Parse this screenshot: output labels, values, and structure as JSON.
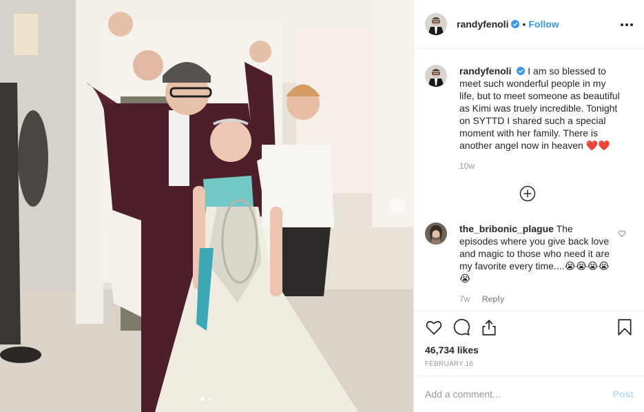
{
  "post": {
    "username": "randyfenoli",
    "separator": "•",
    "follow_label": "Follow",
    "colors": {
      "accent": "#3897f0",
      "verified": "#3897f0",
      "text": "#262626",
      "muted": "#999999",
      "post_disabled": "#b2dffc"
    }
  },
  "caption": {
    "username": "randyfenoli",
    "text": "I am so blessed to meet such wonderful people in my life, but to meet someone as beautiful as Kimi was truely incredible. Tonight on SYTTD I shared such a special moment with her family. There is another angel now in heaven",
    "emoji": "❤️❤️",
    "time": "10w"
  },
  "comment": {
    "username": "the_bribonic_plague",
    "text": "The episodes where you give back love and magic to those who need it are my favorite every time....",
    "emoji": "😭😭😭😭😭",
    "time": "7w",
    "reply_label": "Reply"
  },
  "actions": {
    "likes": "46,734 likes",
    "date": "FEBRUARY 16"
  },
  "add_comment": {
    "placeholder": "Add a comment...",
    "post_label": "Post"
  },
  "icons": {
    "like": "heart-icon",
    "comment": "comment-icon",
    "share": "share-icon",
    "save": "bookmark-icon",
    "more": "more-options-icon",
    "next": "chevron-right-icon",
    "load_more": "plus-circle-icon"
  }
}
